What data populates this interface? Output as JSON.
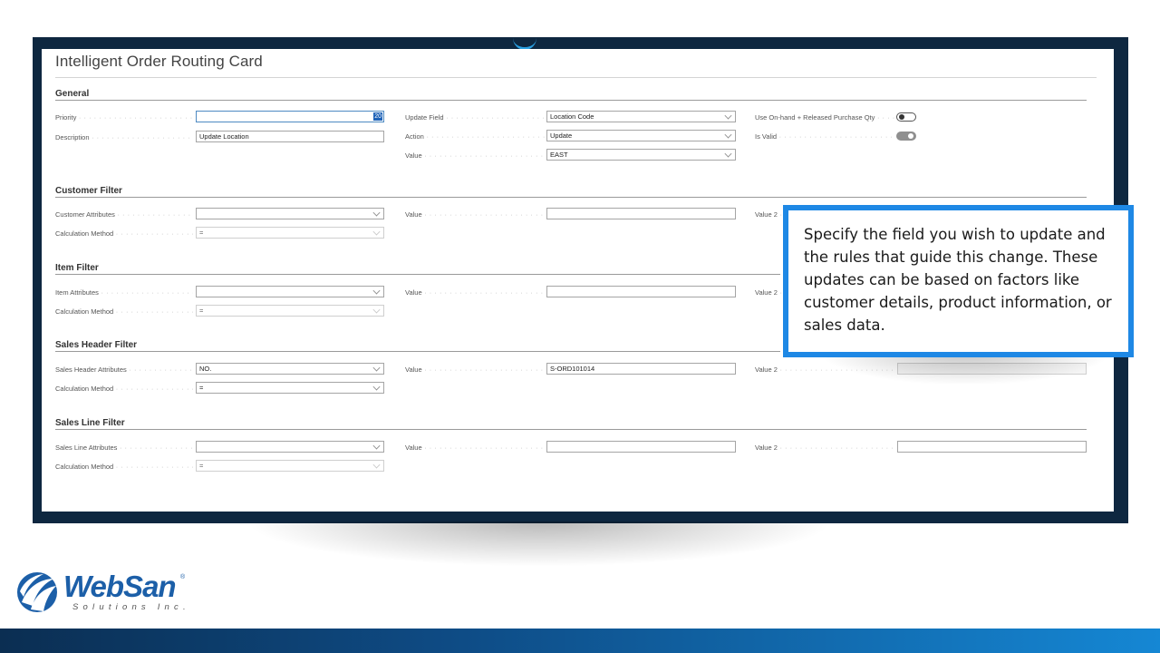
{
  "card_title": "Intelligent Order Routing Card",
  "general": {
    "section_title": "General",
    "priority_label": "Priority",
    "priority_value": "20",
    "description_label": "Description",
    "description_value": "Update Location",
    "update_field_label": "Update Field",
    "update_field_value": "Location Code",
    "action_label": "Action",
    "action_value": "Update",
    "value_label": "Value",
    "value_value": "EAST",
    "use_onhand_label": "Use On-hand + Released Purchase Qty",
    "use_onhand_on": false,
    "is_valid_label": "Is Valid",
    "is_valid_on": true
  },
  "customer_filter": {
    "section_title": "Customer Filter",
    "attributes_label": "Customer Attributes",
    "attributes_value": "",
    "calc_label": "Calculation Method",
    "calc_value": "=",
    "value_label": "Value",
    "value_value": "",
    "value2_label": "Value 2"
  },
  "item_filter": {
    "section_title": "Item Filter",
    "attributes_label": "Item Attributes",
    "attributes_value": "",
    "calc_label": "Calculation Method",
    "calc_value": "=",
    "value_label": "Value",
    "value_value": "",
    "value2_label": "Value 2"
  },
  "sales_header_filter": {
    "section_title": "Sales Header Filter",
    "attributes_label": "Sales Header Attributes",
    "attributes_value": "NO.",
    "calc_label": "Calculation Method",
    "calc_value": "=",
    "value_label": "Value",
    "value_value": "S-ORD101014",
    "value2_label": "Value 2",
    "value2_value": ""
  },
  "sales_line_filter": {
    "section_title": "Sales Line Filter",
    "attributes_label": "Sales Line Attributes",
    "attributes_value": "",
    "calc_label": "Calculation Method",
    "calc_value": "=",
    "value_label": "Value",
    "value_value": "",
    "value2_label": "Value 2",
    "value2_value": ""
  },
  "callout_text": "Specify the field you wish to update and the rules that guide this change. These updates can be based on factors like customer details, product information, or sales data.",
  "logo": {
    "word": "WebSan",
    "registered": "®",
    "sub": "Solutions Inc."
  },
  "colors": {
    "frame": "#0e2740",
    "callout_border": "#1e88e5",
    "brand_blue": "#1c5fa8"
  }
}
